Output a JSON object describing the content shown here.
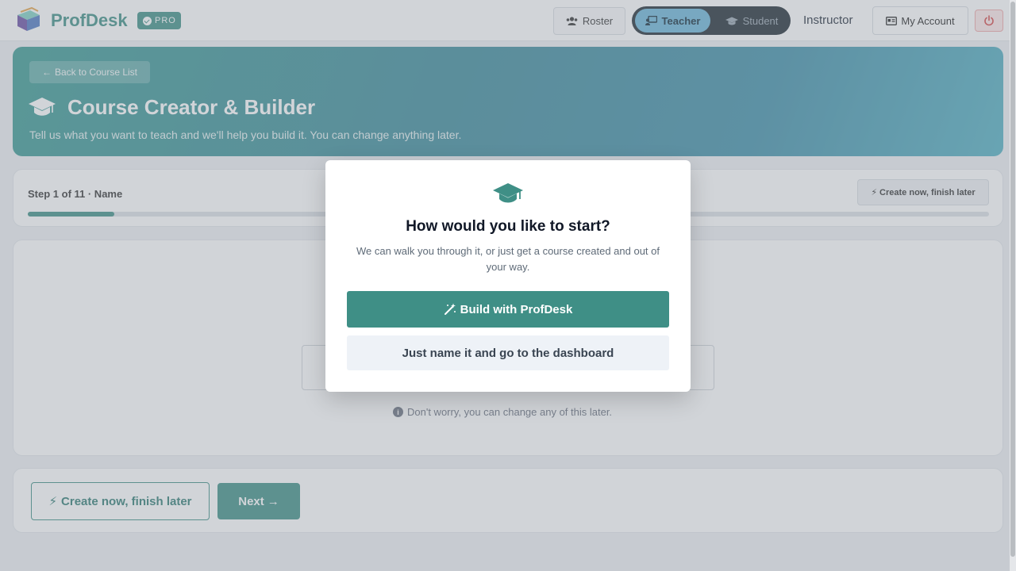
{
  "nav": {
    "brand": "ProfDesk",
    "badge": "PRO",
    "roster_label": "Roster",
    "role_teacher": "Teacher",
    "role_student": "Student",
    "user_role": "Instructor",
    "account_label": "My Account",
    "icons": [
      "book-stack-icon",
      "check-circle-icon",
      "users-icon",
      "chalkboard-teacher-icon",
      "graduation-cap-icon",
      "id-card-icon",
      "power-icon"
    ]
  },
  "hero": {
    "back_label": "Back to Course List",
    "title": "Course Creator & Builder",
    "subtitle": "Tell us what you want to teach and we'll help you build it. You can change anything later."
  },
  "step": {
    "label": "Step 1 of 11 · Name",
    "current": 1,
    "total": 11,
    "progress_fraction": 0.09,
    "create_later_label": "Create now, finish later"
  },
  "main": {
    "hint": "Don't worry, you can change any of this later."
  },
  "footer": {
    "create_later_label": "Create now, finish later",
    "next_label": "Next"
  },
  "modal": {
    "title": "How would you like to start?",
    "description": "We can walk you through it, or just get a course created and out of your way.",
    "build_label": "Build with ProfDesk",
    "just_name_label": "Just name it and go to the dashboard"
  },
  "colors": {
    "accent": "#3f8f86",
    "brand_text": "#3f8f86",
    "hero_gradient_start": "#3a9a92",
    "hero_gradient_end": "#52b0c2",
    "role_active": "#6bb6d9",
    "power_bg": "#fde8e8"
  }
}
